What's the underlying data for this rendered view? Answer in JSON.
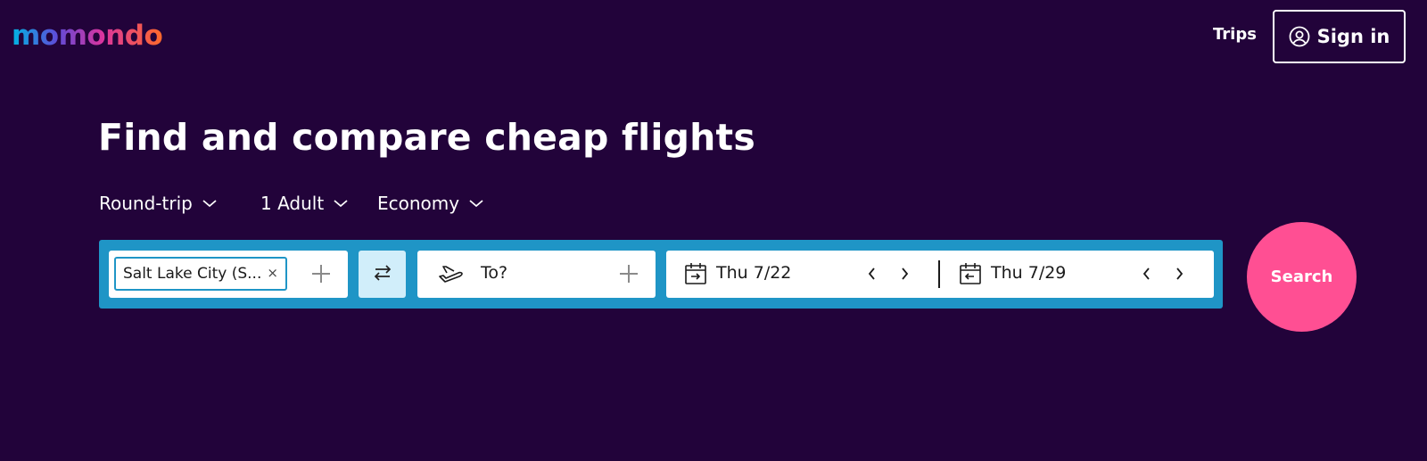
{
  "header": {
    "logo_text": "momondo",
    "trips_label": "Trips",
    "signin_label": "Sign in"
  },
  "hero": {
    "title": "Find and compare cheap flights"
  },
  "options": {
    "trip_type": "Round-trip",
    "travelers": "1 Adult",
    "cabin": "Economy"
  },
  "search_form": {
    "origin_chip": "Salt Lake City (S...",
    "origin_chip_close": "×",
    "destination_placeholder": "To?",
    "depart_date": "Thu 7/22",
    "return_date": "Thu 7/29",
    "search_label": "Search"
  },
  "icons": {
    "user": "user-circle-icon",
    "chevron": "chevron-down-icon",
    "plus": "plus-icon",
    "swap": "swap-arrows-icon",
    "plane": "plane-icon",
    "calendar": "calendar-icon",
    "prev": "chevron-left-icon",
    "next": "chevron-right-icon"
  },
  "colors": {
    "background": "#22033a",
    "search_bar": "#1f95c6",
    "swap_button": "#d1eefa",
    "search_button": "#ff4f93"
  }
}
